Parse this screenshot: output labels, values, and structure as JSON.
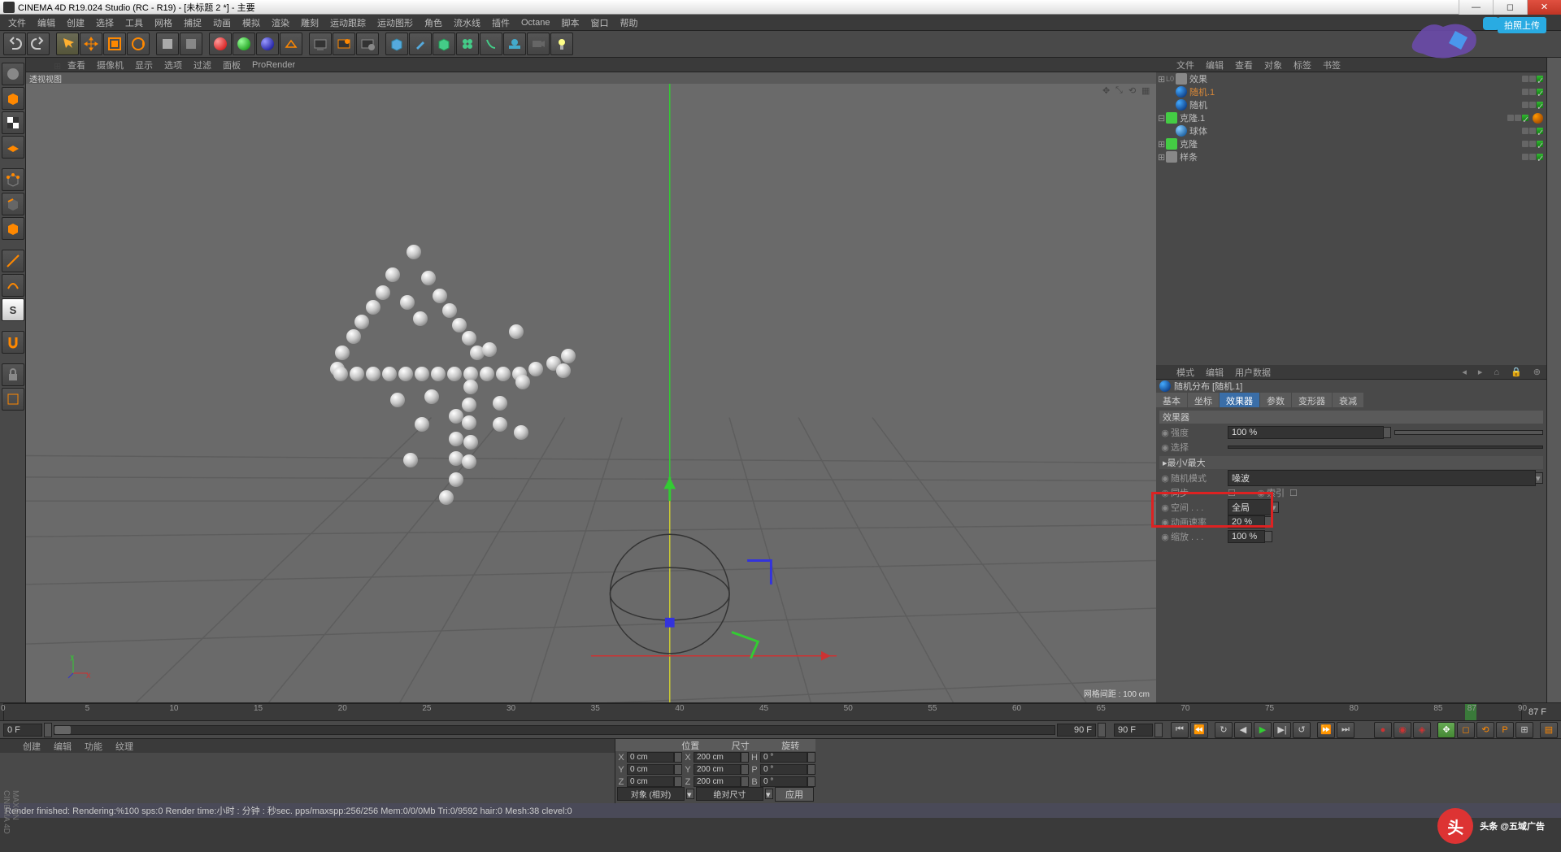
{
  "title": "CINEMA 4D R19.024 Studio (RC - R19) - [未标题 2 *] - 主要",
  "menu": [
    "文件",
    "编辑",
    "创建",
    "选择",
    "工具",
    "网格",
    "捕捉",
    "动画",
    "模拟",
    "渲染",
    "雕刻",
    "运动跟踪",
    "运动图形",
    "角色",
    "流水线",
    "插件",
    "Octane",
    "脚本",
    "窗口",
    "帮助"
  ],
  "upload_label": "拍照上传",
  "vp_menu": [
    "查看",
    "摄像机",
    "显示",
    "选项",
    "过滤",
    "面板",
    "ProRender"
  ],
  "vp_title": "透视视图",
  "vp_grid_label": "网格间距 : 100 cm",
  "om_menu": [
    "文件",
    "编辑",
    "查看",
    "对象",
    "标签",
    "书签"
  ],
  "om_tree": [
    {
      "depth": 0,
      "exp": "⊞",
      "name": "效果",
      "icon": "fx",
      "sel": false,
      "l0": true
    },
    {
      "depth": 1,
      "exp": "",
      "name": "随机.1",
      "icon": "rand",
      "sel": true
    },
    {
      "depth": 1,
      "exp": "",
      "name": "随机",
      "icon": "rand",
      "sel": false
    },
    {
      "depth": 0,
      "exp": "⊟",
      "name": "克隆.1",
      "icon": "clone",
      "sel": false,
      "tag": true
    },
    {
      "depth": 1,
      "exp": "",
      "name": "球体",
      "icon": "sphere",
      "sel": false
    },
    {
      "depth": 0,
      "exp": "⊞",
      "name": "克隆",
      "icon": "clone",
      "sel": false
    },
    {
      "depth": 0,
      "exp": "⊞",
      "name": "样条",
      "icon": "spline",
      "sel": false
    }
  ],
  "am_menu": [
    "模式",
    "编辑",
    "用户数据"
  ],
  "am_head": "随机分布 [随机.1]",
  "am_tabs": [
    "基本",
    "坐标",
    "效果器",
    "参数",
    "变形器",
    "衰减"
  ],
  "am_active_tab": 2,
  "am_section": "效果器",
  "am": {
    "strength_lbl": "强度",
    "strength_val": "100 %",
    "select_lbl": "选择",
    "minmax_lbl": "最小/最大",
    "mode_lbl": "随机模式",
    "mode_val": "噪波",
    "sync_lbl": "同步",
    "index_lbl": "索引",
    "space_lbl": "空间 . . .",
    "space_val": "全局",
    "speed_lbl": "动画速率",
    "speed_val": "20 %",
    "scale_lbl": "缩放 . . .",
    "scale_val": "100 %"
  },
  "timeline": {
    "start": "0 F",
    "end": "90 F",
    "cur": "87 F",
    "ticks": [
      0,
      5,
      10,
      15,
      20,
      25,
      30,
      35,
      40,
      45,
      50,
      55,
      60,
      65,
      70,
      75,
      80,
      85,
      87,
      90
    ]
  },
  "coords_menu": [
    "创建",
    "编辑",
    "功能",
    "纹理"
  ],
  "coords": {
    "head": [
      "位置",
      "尺寸",
      "旋转"
    ],
    "X": {
      "p": "0 cm",
      "s": "200 cm",
      "r": "0 °",
      "rl": "H"
    },
    "Y": {
      "p": "0 cm",
      "s": "200 cm",
      "r": "0 °",
      "rl": "P"
    },
    "Z": {
      "p": "0 cm",
      "s": "200 cm",
      "r": "0 °",
      "rl": "B"
    },
    "mode1": "对象 (相对)",
    "mode2": "绝对尺寸",
    "apply": "应用"
  },
  "status": "Render finished: Rendering:%100 sps:0 Render time:小时 : 分钟 : 秒sec. pps/maxspp:256/256 Mem:0/0/0Mb Tri:0/9592 hair:0 Mesh:38 clevel:0",
  "watermark": "头条 @五域广告",
  "spheres": [
    [
      468,
      198
    ],
    [
      442,
      226
    ],
    [
      486,
      230
    ],
    [
      430,
      248
    ],
    [
      500,
      252
    ],
    [
      418,
      266
    ],
    [
      512,
      270
    ],
    [
      404,
      284
    ],
    [
      524,
      288
    ],
    [
      460,
      260
    ],
    [
      476,
      280
    ],
    [
      394,
      302
    ],
    [
      536,
      304
    ],
    [
      380,
      322
    ],
    [
      546,
      322
    ],
    [
      374,
      342
    ],
    [
      561,
      318
    ],
    [
      594,
      296
    ],
    [
      378,
      348
    ],
    [
      398,
      348
    ],
    [
      418,
      348
    ],
    [
      438,
      348
    ],
    [
      458,
      348
    ],
    [
      478,
      348
    ],
    [
      498,
      348
    ],
    [
      518,
      348
    ],
    [
      538,
      348
    ],
    [
      558,
      348
    ],
    [
      578,
      348
    ],
    [
      598,
      348
    ],
    [
      618,
      342
    ],
    [
      640,
      335
    ],
    [
      658,
      326
    ],
    [
      538,
      364
    ],
    [
      536,
      386
    ],
    [
      520,
      400
    ],
    [
      536,
      408
    ],
    [
      520,
      428
    ],
    [
      538,
      432
    ],
    [
      520,
      452
    ],
    [
      536,
      456
    ],
    [
      520,
      478
    ],
    [
      448,
      380
    ],
    [
      490,
      376
    ],
    [
      574,
      384
    ],
    [
      602,
      358
    ],
    [
      652,
      344
    ],
    [
      574,
      410
    ],
    [
      478,
      410
    ],
    [
      464,
      454
    ],
    [
      600,
      420
    ],
    [
      508,
      500
    ]
  ]
}
